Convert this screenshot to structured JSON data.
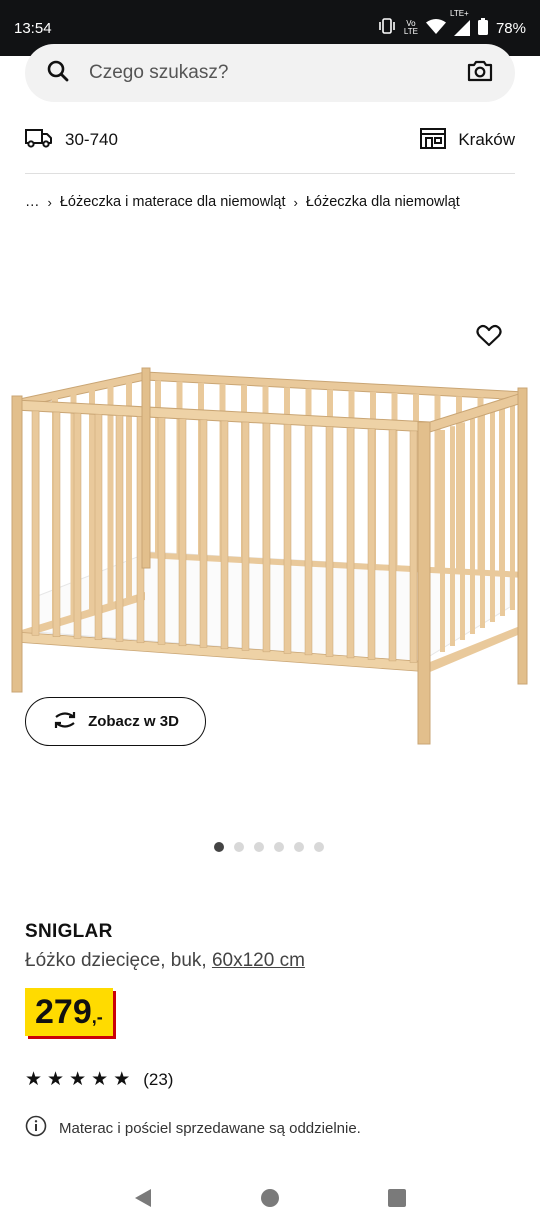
{
  "status": {
    "time": "13:54",
    "volte": "Vo",
    "lte_small": "LTE",
    "lte_plus": "LTE+",
    "battery": "78%"
  },
  "search": {
    "placeholder": "Czego szukasz?"
  },
  "location": {
    "postal": "30-740",
    "store": "Kraków"
  },
  "breadcrumb": {
    "ellipsis": "…",
    "items": [
      "Łóżeczka i materace dla niemowląt",
      "Łóżeczka dla niemowląt"
    ]
  },
  "gallery": {
    "button_3d": "Zobacz w 3D",
    "dots_total": 6,
    "dot_active": 1
  },
  "product": {
    "name": "SNIGLAR",
    "desc": "Łóżko dziecięce, buk,",
    "size": "60x120 cm",
    "price": "279",
    "price_suffix": ",-",
    "rating": 5,
    "reviews": "(23)",
    "note": "Materac i pościel sprzedawane są oddzielnie."
  },
  "colors": {
    "price_bg": "#ffdb00",
    "price_shadow": "#cc0008",
    "wood": "#e9c99b"
  }
}
